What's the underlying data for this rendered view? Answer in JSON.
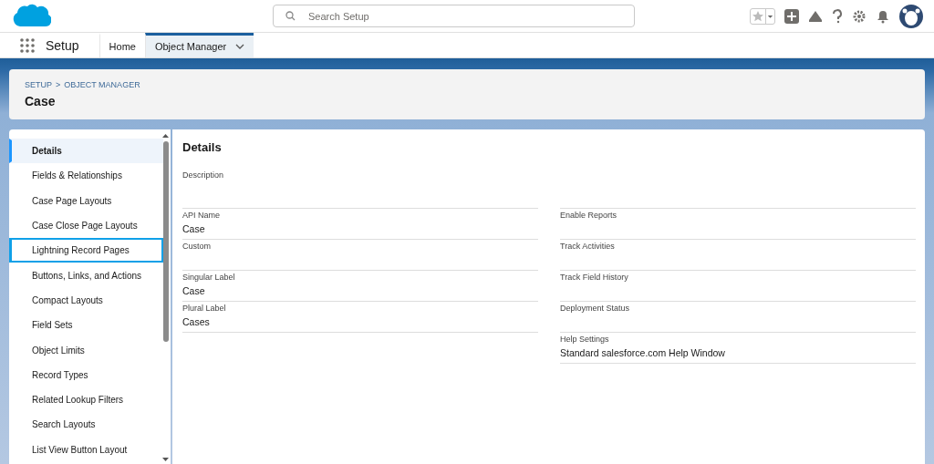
{
  "header": {
    "search": {
      "placeholder": "Search Setup"
    }
  },
  "nav": {
    "app_name": "Setup",
    "tabs": [
      {
        "label": "Home",
        "selected": false
      },
      {
        "label": "Object Manager",
        "selected": true
      }
    ]
  },
  "breadcrumb": {
    "path": [
      "SETUP",
      "OBJECT MANAGER"
    ],
    "separator": ">",
    "title": "Case"
  },
  "sidebar": {
    "items": [
      {
        "label": "Details",
        "selected": true,
        "focused": false
      },
      {
        "label": "Fields & Relationships",
        "selected": false,
        "focused": false
      },
      {
        "label": "Case Page Layouts",
        "selected": false,
        "focused": false
      },
      {
        "label": "Case Close Page Layouts",
        "selected": false,
        "focused": false
      },
      {
        "label": "Lightning Record Pages",
        "selected": false,
        "focused": true
      },
      {
        "label": "Buttons, Links, and Actions",
        "selected": false,
        "focused": false
      },
      {
        "label": "Compact Layouts",
        "selected": false,
        "focused": false
      },
      {
        "label": "Field Sets",
        "selected": false,
        "focused": false
      },
      {
        "label": "Object Limits",
        "selected": false,
        "focused": false
      },
      {
        "label": "Record Types",
        "selected": false,
        "focused": false
      },
      {
        "label": "Related Lookup Filters",
        "selected": false,
        "focused": false
      },
      {
        "label": "Search Layouts",
        "selected": false,
        "focused": false
      },
      {
        "label": "List View Button Layout",
        "selected": false,
        "focused": false
      }
    ]
  },
  "details": {
    "title": "Details",
    "description": {
      "label": "Description"
    },
    "left_fields": [
      {
        "label": "API Name",
        "value": "Case"
      },
      {
        "label": "Custom"
      },
      {
        "label": "Singular Label",
        "value": "Case"
      },
      {
        "label": "Plural Label",
        "value": "Cases"
      }
    ],
    "right_fields": [
      {
        "label": "Enable Reports"
      },
      {
        "label": "Track Activities"
      },
      {
        "label": "Track Field History"
      },
      {
        "label": "Deployment Status"
      },
      {
        "label": "Help Settings",
        "value": "Standard salesforce.com Help Window"
      }
    ]
  }
}
